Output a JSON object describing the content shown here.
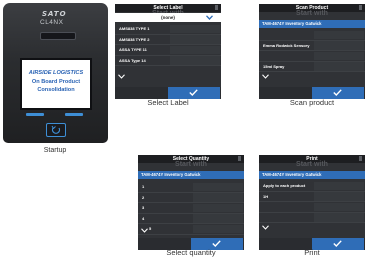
{
  "startup": {
    "brand": "SATO",
    "model": "CL4NX",
    "screen_line1": "AIRSIDE LOGISTICS",
    "screen_line2": "On Board Product",
    "screen_line3": "Consolidation",
    "caption": "Startup"
  },
  "select_label": {
    "title": "Select Label",
    "ghost": "Start with",
    "selected": "(none)",
    "items": [
      "AMS838 TYPE 1",
      "AMS838 TYPE 2",
      "ASSA TYPE 11",
      "ASSA Type 14"
    ],
    "caption": "Select Label"
  },
  "scan_product": {
    "title": "Scan Product",
    "ghost": "Start with",
    "header": "TAM-4674Y Inventory Gatwick",
    "items": [
      "",
      "Emma Rodwick Sensory",
      "",
      "15ml Spray"
    ],
    "caption": "Scan product"
  },
  "select_quantity": {
    "title": "Select Quantity",
    "ghost": "Start with",
    "header": "TAM-4674Y Inventory Gatwick",
    "items": [
      "1",
      "2",
      "3",
      "4",
      "5"
    ],
    "caption": "Select quantity"
  },
  "print": {
    "title": "Print",
    "ghost": "Start with",
    "header": "TAM-4674Y Inventory Gatwick",
    "items": [
      "Apply to each product",
      "1H",
      "",
      ""
    ],
    "caption": "Print"
  },
  "colors": {
    "accent_blue": "#2f6db7",
    "panel_bg": "#303236",
    "screen_text_blue": "#2a63b4"
  }
}
